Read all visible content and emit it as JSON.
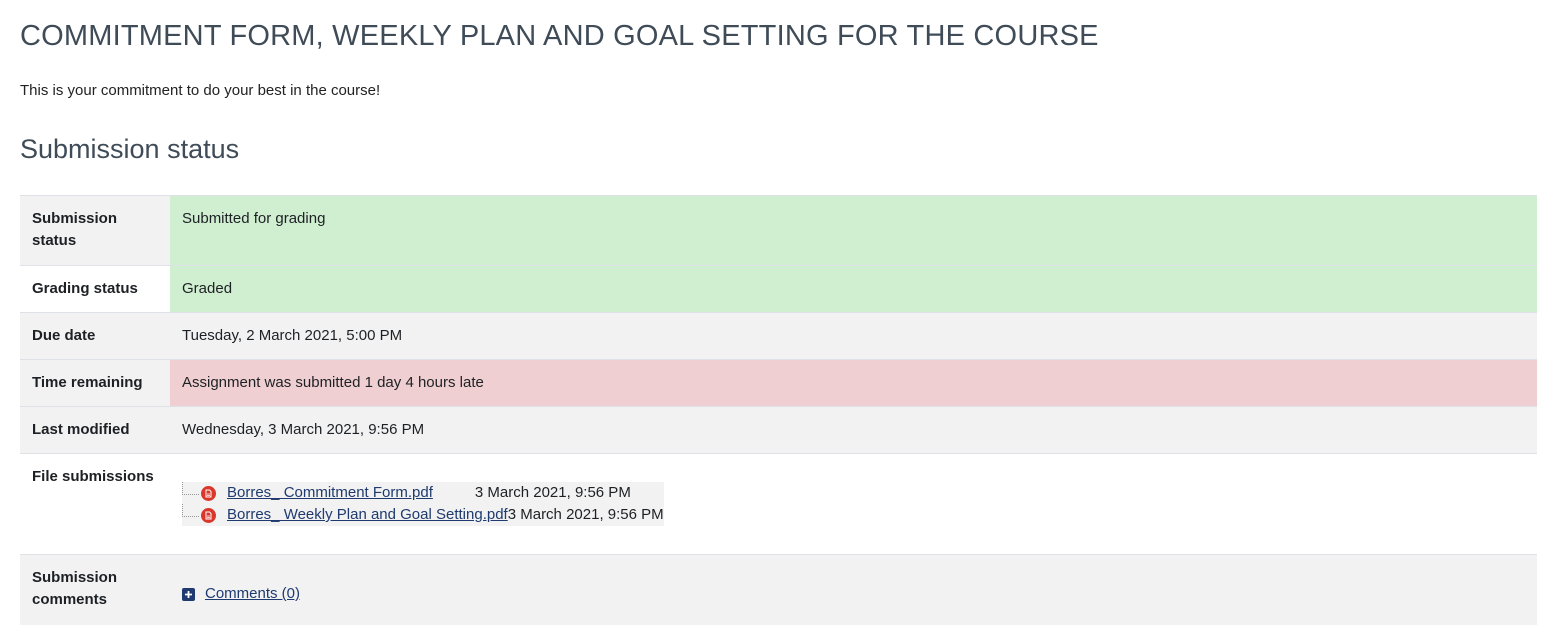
{
  "page": {
    "title": "COMMITMENT FORM, WEEKLY PLAN AND GOAL SETTING FOR THE COURSE",
    "intro": "This is your commitment to do your best in the course!",
    "section_heading": "Submission status"
  },
  "status_table": {
    "submission_status": {
      "label": "Submission status",
      "value": "Submitted for grading"
    },
    "grading_status": {
      "label": "Grading status",
      "value": "Graded"
    },
    "due_date": {
      "label": "Due date",
      "value": "Tuesday, 2 March 2021, 5:00 PM"
    },
    "time_remaining": {
      "label": "Time remaining",
      "value": "Assignment was submitted 1 day 4 hours late"
    },
    "last_modified": {
      "label": "Last modified",
      "value": "Wednesday, 3 March 2021, 9:56 PM"
    },
    "file_submissions": {
      "label": "File submissions",
      "files": [
        {
          "name": "Borres_ Commitment Form.pdf",
          "date": "3 March 2021, 9:56 PM",
          "icon": "pdf-icon"
        },
        {
          "name": "Borres_ Weekly Plan and Goal Setting.pdf",
          "date": "3 March 2021, 9:56 PM",
          "icon": "pdf-icon"
        }
      ]
    },
    "submission_comments": {
      "label": "Submission comments",
      "link": "Comments (0)",
      "icon": "plus-square-icon"
    }
  },
  "colors": {
    "success_bg": "#d0eed0",
    "danger_bg": "#efcfd1",
    "row_gray": "#f2f2f2",
    "link": "#1e3a6e",
    "heading": "#3f4c58",
    "pdf_red": "#d9372b"
  }
}
